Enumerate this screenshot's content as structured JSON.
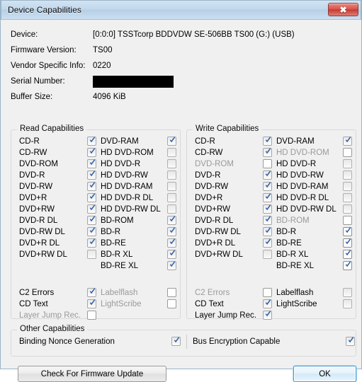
{
  "window": {
    "title": "Device Capabilities",
    "close_label": "✖"
  },
  "info": {
    "rows": [
      {
        "label": "Device:",
        "value": "[0:0:0] TSSTcorp BDDVDW SE-506BB TS00 (G:) (USB)"
      },
      {
        "label": "Firmware Version:",
        "value": "TS00"
      },
      {
        "label": "Vendor Specific Info:",
        "value": "0220"
      },
      {
        "label": "Serial Number:",
        "value": ""
      },
      {
        "label": "Buffer Size:",
        "value": "4096 KiB"
      }
    ]
  },
  "read": {
    "title": "Read Capabilities",
    "col_a": [
      {
        "label": "CD-R",
        "checked": true,
        "enabled": false
      },
      {
        "label": "CD-RW",
        "checked": true,
        "enabled": false
      },
      {
        "label": "DVD-ROM",
        "checked": true,
        "enabled": false
      },
      {
        "label": "DVD-R",
        "checked": true,
        "enabled": false
      },
      {
        "label": "DVD-RW",
        "checked": true,
        "enabled": false
      },
      {
        "label": "DVD+R",
        "checked": true,
        "enabled": false
      },
      {
        "label": "DVD+RW",
        "checked": true,
        "enabled": false
      },
      {
        "label": "DVD-R DL",
        "checked": true,
        "enabled": false
      },
      {
        "label": "DVD-RW DL",
        "checked": true,
        "enabled": false
      },
      {
        "label": "DVD+R DL",
        "checked": true,
        "enabled": false
      },
      {
        "label": "DVD+RW DL",
        "checked": false,
        "enabled": false
      }
    ],
    "col_b": [
      {
        "label": "DVD-RAM",
        "checked": true,
        "enabled": false
      },
      {
        "label": "HD DVD-ROM",
        "checked": false,
        "enabled": false
      },
      {
        "label": "HD DVD-R",
        "checked": false,
        "enabled": false
      },
      {
        "label": "HD DVD-RW",
        "checked": false,
        "enabled": false
      },
      {
        "label": "HD DVD-RAM",
        "checked": false,
        "enabled": false
      },
      {
        "label": "HD DVD-R DL",
        "checked": false,
        "enabled": false
      },
      {
        "label": "HD DVD-RW DL",
        "checked": false,
        "enabled": false
      },
      {
        "label": "BD-ROM",
        "checked": true,
        "enabled": false
      },
      {
        "label": "BD-R",
        "checked": true,
        "enabled": false
      },
      {
        "label": "BD-RE",
        "checked": true,
        "enabled": false
      },
      {
        "label": "BD-R XL",
        "checked": true,
        "enabled": false
      },
      {
        "label": "BD-RE XL",
        "checked": true,
        "enabled": false
      }
    ],
    "extras_a": [
      {
        "label": "C2 Errors",
        "checked": true,
        "enabled": false
      },
      {
        "label": "CD Text",
        "checked": true,
        "enabled": false
      },
      {
        "label": "Layer Jump Rec.",
        "checked": false,
        "enabled": true,
        "dim": true
      }
    ],
    "extras_b": [
      {
        "label": "Labelflash",
        "checked": false,
        "enabled": true,
        "dim": true
      },
      {
        "label": "LightScribe",
        "checked": false,
        "enabled": true,
        "dim": true
      }
    ]
  },
  "write": {
    "title": "Write Capabilities",
    "col_a": [
      {
        "label": "CD-R",
        "checked": true,
        "enabled": false
      },
      {
        "label": "CD-RW",
        "checked": true,
        "enabled": false
      },
      {
        "label": "DVD-ROM",
        "checked": false,
        "enabled": true,
        "dim": true
      },
      {
        "label": "DVD-R",
        "checked": true,
        "enabled": false
      },
      {
        "label": "DVD-RW",
        "checked": true,
        "enabled": false
      },
      {
        "label": "DVD+R",
        "checked": true,
        "enabled": false
      },
      {
        "label": "DVD+RW",
        "checked": true,
        "enabled": false
      },
      {
        "label": "DVD-R DL",
        "checked": true,
        "enabled": false
      },
      {
        "label": "DVD-RW DL",
        "checked": true,
        "enabled": false
      },
      {
        "label": "DVD+R DL",
        "checked": true,
        "enabled": false
      },
      {
        "label": "DVD+RW DL",
        "checked": false,
        "enabled": false
      }
    ],
    "col_b": [
      {
        "label": "DVD-RAM",
        "checked": true,
        "enabled": false
      },
      {
        "label": "HD DVD-ROM",
        "checked": false,
        "enabled": true,
        "dim": true
      },
      {
        "label": "HD DVD-R",
        "checked": false,
        "enabled": false
      },
      {
        "label": "HD DVD-RW",
        "checked": false,
        "enabled": false
      },
      {
        "label": "HD DVD-RAM",
        "checked": false,
        "enabled": false
      },
      {
        "label": "HD DVD-R DL",
        "checked": false,
        "enabled": false
      },
      {
        "label": "HD DVD-RW DL",
        "checked": false,
        "enabled": false
      },
      {
        "label": "BD-ROM",
        "checked": false,
        "enabled": true,
        "dim": true
      },
      {
        "label": "BD-R",
        "checked": true,
        "enabled": true
      },
      {
        "label": "BD-RE",
        "checked": true,
        "enabled": true
      },
      {
        "label": "BD-R XL",
        "checked": true,
        "enabled": true
      },
      {
        "label": "BD-RE XL",
        "checked": true,
        "enabled": true
      }
    ],
    "extras_a": [
      {
        "label": "C2 Errors",
        "checked": false,
        "enabled": true,
        "dim": true
      },
      {
        "label": "CD Text",
        "checked": true,
        "enabled": false
      },
      {
        "label": "Layer Jump Rec.",
        "checked": true,
        "enabled": false
      }
    ],
    "extras_b": [
      {
        "label": "Labelflash",
        "checked": false,
        "enabled": false
      },
      {
        "label": "LightScribe",
        "checked": false,
        "enabled": false
      }
    ]
  },
  "other": {
    "title": "Other Capabilities",
    "left": {
      "label": "Binding Nonce Generation",
      "checked": true,
      "enabled": false
    },
    "right": {
      "label": "Bus Encryption Capable",
      "checked": true,
      "enabled": false
    }
  },
  "buttons": {
    "firmware": "Check For Firmware Update",
    "ok": "OK"
  }
}
